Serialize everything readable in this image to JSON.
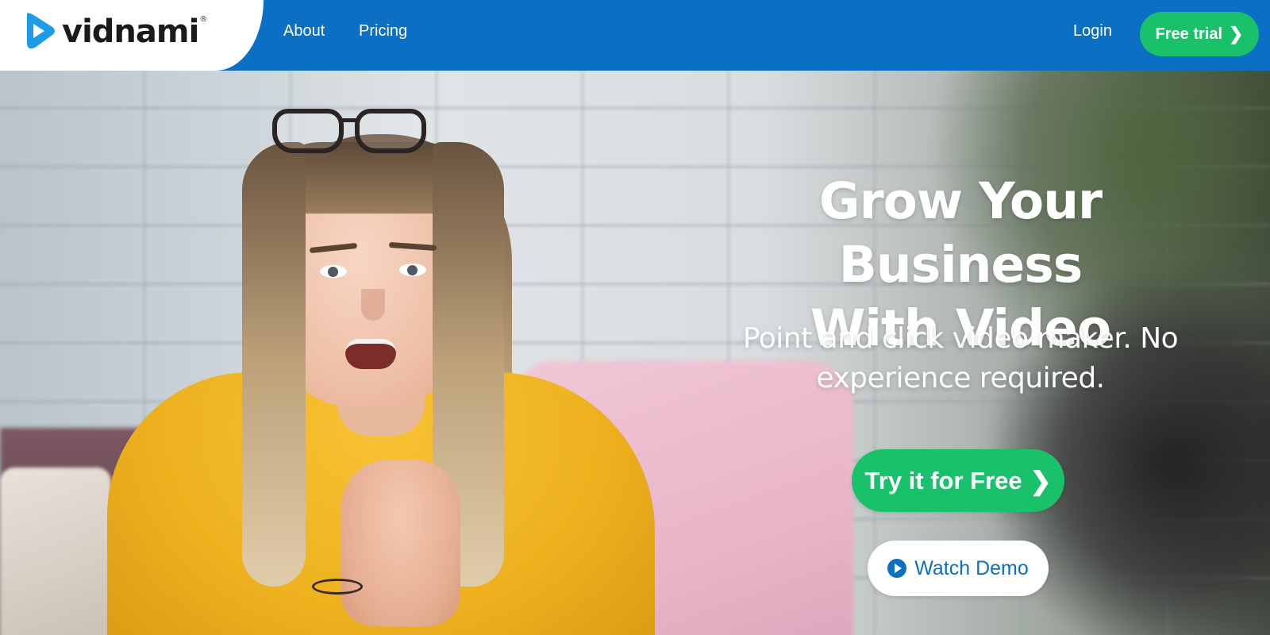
{
  "brand": {
    "name": "vidnami",
    "registered_mark": "®",
    "colors": {
      "primary_blue": "#0b6fc4",
      "cta_green": "#19c16a",
      "white": "#ffffff"
    }
  },
  "nav": {
    "links": [
      {
        "label": "About"
      },
      {
        "label": "Pricing"
      }
    ],
    "login_label": "Login",
    "free_trial_label": "Free trial",
    "free_trial_icon": "chevron-right-icon"
  },
  "hero": {
    "title_line1": "Grow Your Business",
    "title_line2": "With Video",
    "subtitle_line1": "Point and click video maker. No",
    "subtitle_line2": "experience required.",
    "primary_cta_label": "Try it for Free",
    "primary_cta_icon": "chevron-right-icon",
    "secondary_cta_label": "Watch Demo",
    "secondary_cta_icon": "play-circle-icon",
    "background_image": "woman-talking-to-camera"
  }
}
